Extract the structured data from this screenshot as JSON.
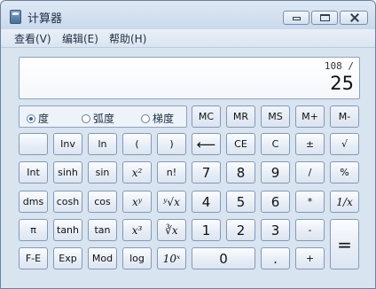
{
  "window": {
    "title": "计算器"
  },
  "menu": {
    "items": [
      "查看(V)",
      "编辑(E)",
      "帮助(H)"
    ]
  },
  "display": {
    "expression": "108 /",
    "value": "25"
  },
  "angle": {
    "options": [
      "度",
      "弧度",
      "梯度"
    ],
    "selected": "度"
  },
  "memory": [
    "MC",
    "MR",
    "MS",
    "M+",
    "M-"
  ],
  "buttons": {
    "row1": [
      "",
      "Inv",
      "ln",
      "(",
      ")",
      "⟵",
      "CE",
      "C",
      "±",
      "√"
    ],
    "row2": [
      "Int",
      "sinh",
      "sin",
      "x²",
      "n!",
      "7",
      "8",
      "9",
      "/",
      "%"
    ],
    "row3": [
      "dms",
      "cosh",
      "cos",
      "xʸ",
      "ʸ√x",
      "4",
      "5",
      "6",
      "*",
      "1/x"
    ],
    "row4": [
      "π",
      "tanh",
      "tan",
      "x³",
      "∛x",
      "1",
      "2",
      "3",
      "-",
      "="
    ],
    "row5": [
      "F-E",
      "Exp",
      "Mod",
      "log",
      "10ˣ",
      "0",
      ".",
      "+"
    ]
  }
}
